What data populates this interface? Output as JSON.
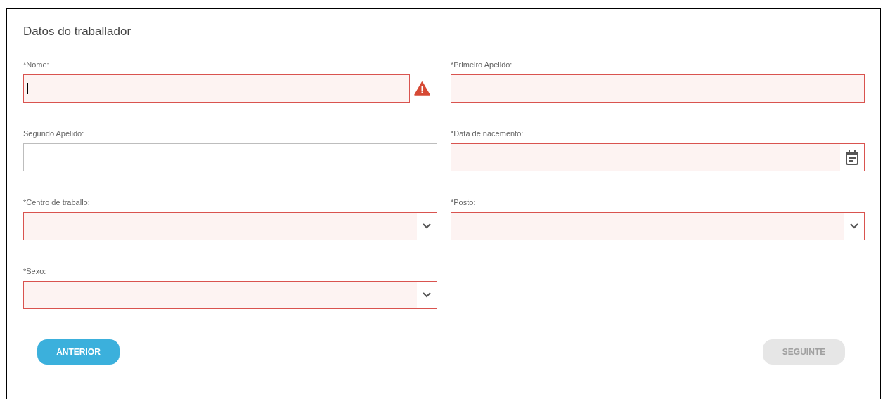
{
  "title": "Datos do traballador",
  "fields": [
    {
      "label": "*Nome:",
      "kind": "text",
      "invalid": true,
      "focused": true,
      "warning": true
    },
    {
      "label": "*Primeiro Apelido:",
      "kind": "text",
      "invalid": true,
      "focused": false,
      "warning": false
    },
    {
      "label": "Segundo Apelido:",
      "kind": "text",
      "invalid": false,
      "focused": false,
      "warning": false
    },
    {
      "label": "*Data de nacemento:",
      "kind": "date",
      "invalid": true,
      "focused": false,
      "warning": false
    },
    {
      "label": "*Centro de traballo:",
      "kind": "select",
      "invalid": true,
      "focused": false,
      "warning": false
    },
    {
      "label": "*Posto:",
      "kind": "select",
      "invalid": true,
      "focused": false,
      "warning": false
    },
    {
      "label": "*Sexo:",
      "kind": "select",
      "invalid": true,
      "focused": false,
      "warning": false
    }
  ],
  "buttons": [
    {
      "label": "ANTERIOR",
      "disabled": false
    },
    {
      "label": "SEGUINTE",
      "disabled": true
    }
  ]
}
